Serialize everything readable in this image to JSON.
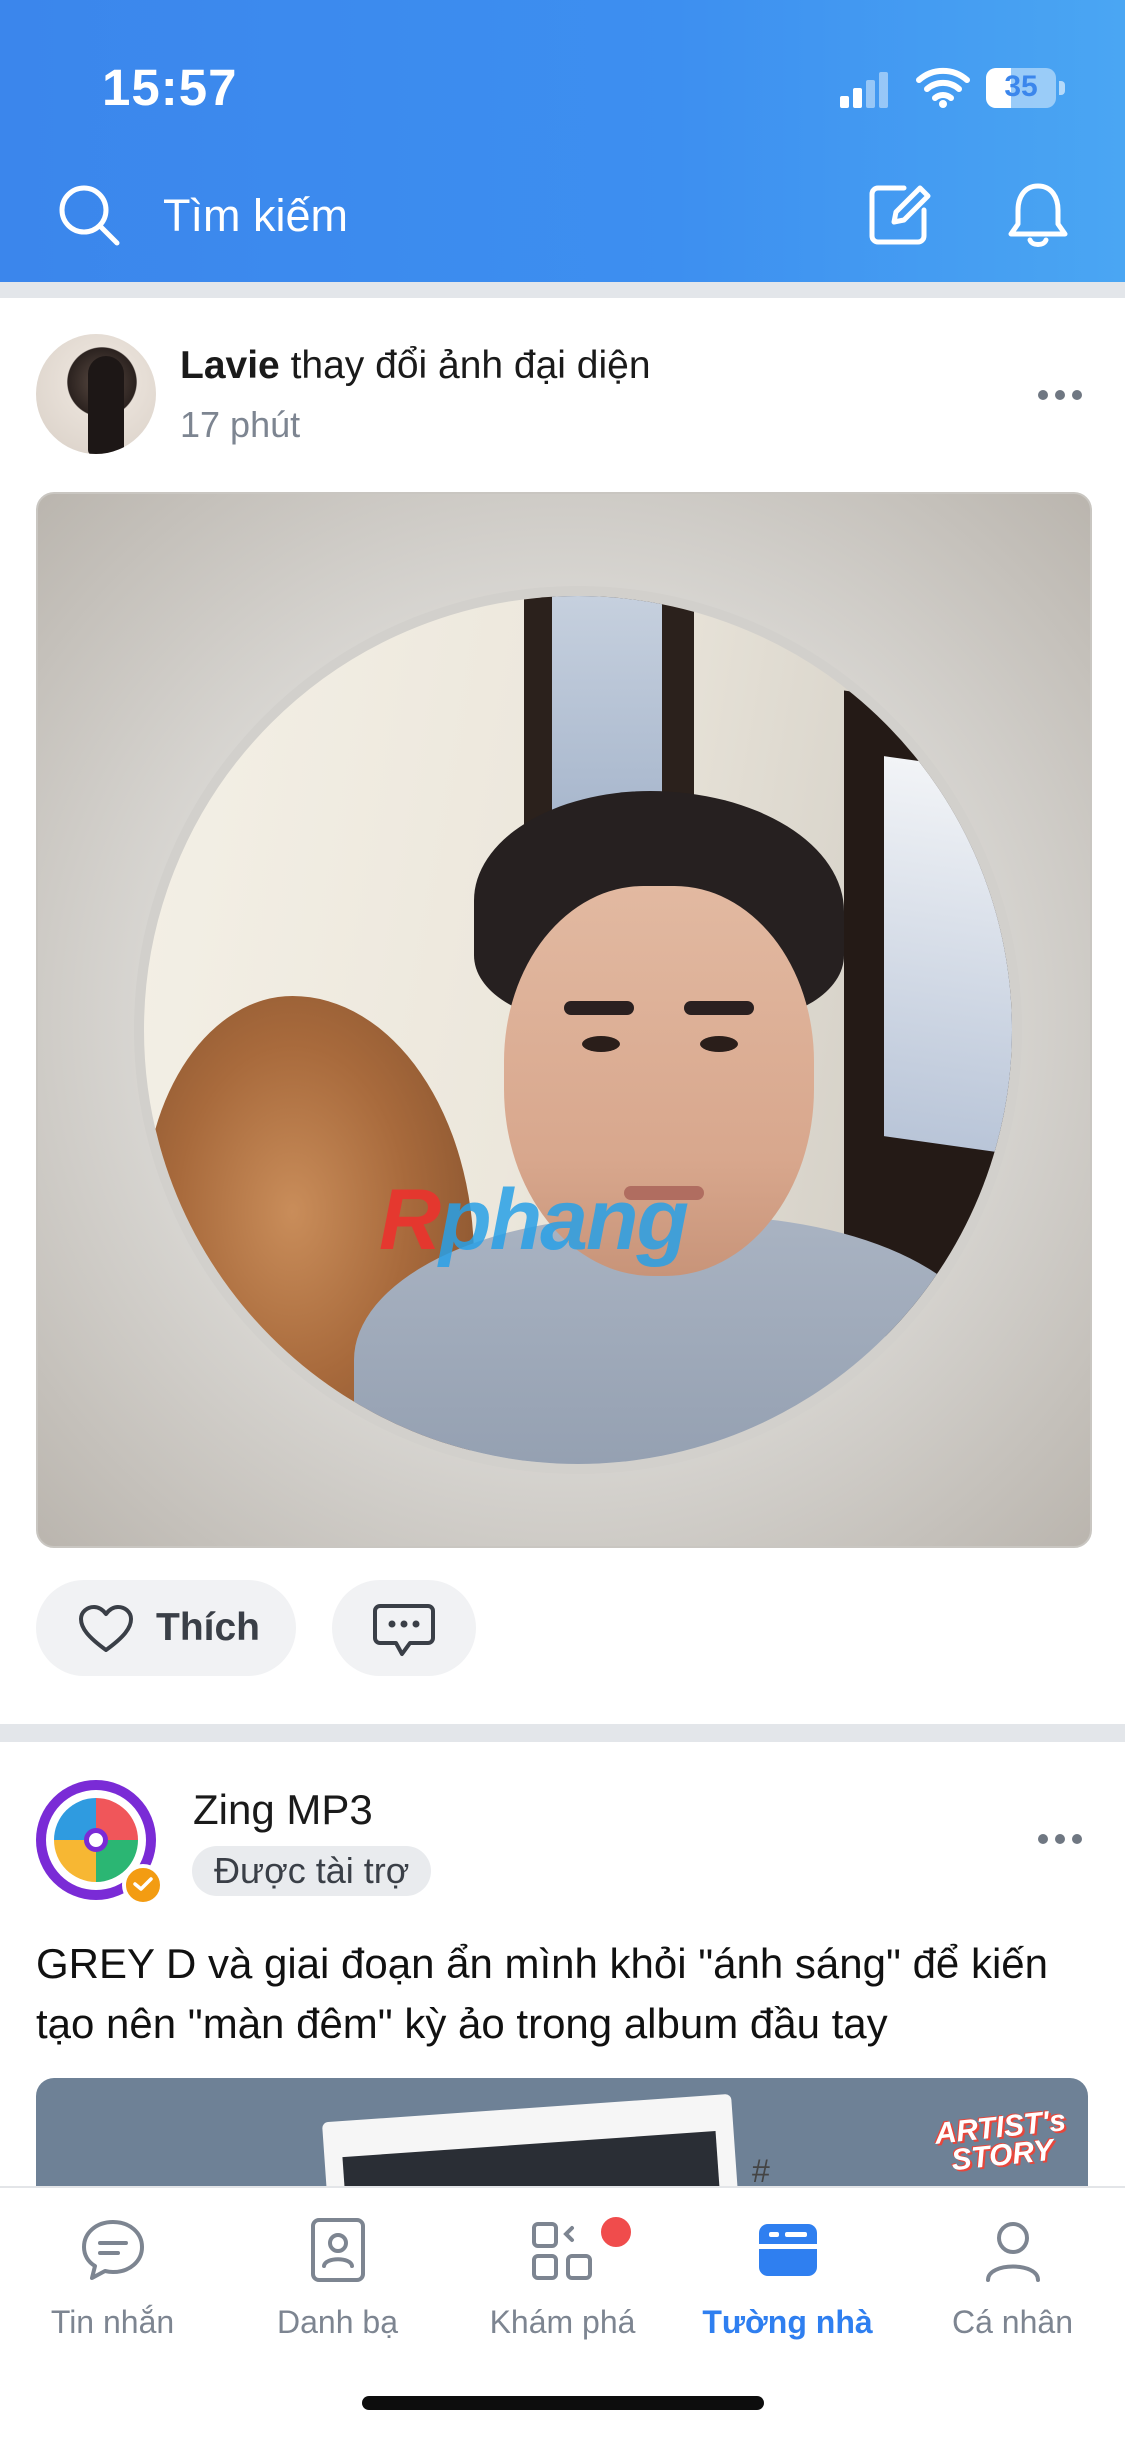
{
  "status_bar": {
    "time": "15:57",
    "battery_level": "35",
    "battery_fraction": 0.35
  },
  "header": {
    "search_placeholder": "Tìm kiếm",
    "icons": [
      "search-icon",
      "compose-icon",
      "bell-icon"
    ],
    "gradient_colors": [
      "#3b86ec",
      "#4aa6f3"
    ]
  },
  "post1": {
    "author": "Lavie",
    "action": "thay đổi ảnh đại diện",
    "time": "17 phút",
    "watermark": {
      "r": "R",
      "rest": "phang"
    },
    "like_label": "Thích"
  },
  "post2": {
    "brand": "Zing MP3",
    "sponsored": "Được tài trợ",
    "text": "GREY D và giai đoạn ẩn mình khỏi \"ánh sáng\" để kiến tạo nên \"màn đêm\" kỳ ảo trong album đầu tay",
    "hashtag": "#",
    "tag_line1": "ARTIST's",
    "tag_line2": "STORY"
  },
  "nav": {
    "items": [
      {
        "label": "Tin nhắn",
        "icon": "chat-icon"
      },
      {
        "label": "Danh bạ",
        "icon": "contacts-icon"
      },
      {
        "label": "Khám phá",
        "icon": "explore-icon"
      },
      {
        "label": "Tường nhà",
        "icon": "timeline-icon"
      },
      {
        "label": "Cá nhân",
        "icon": "person-icon"
      }
    ],
    "active": "Tường nhà",
    "active_color": "#2f7ff0"
  }
}
